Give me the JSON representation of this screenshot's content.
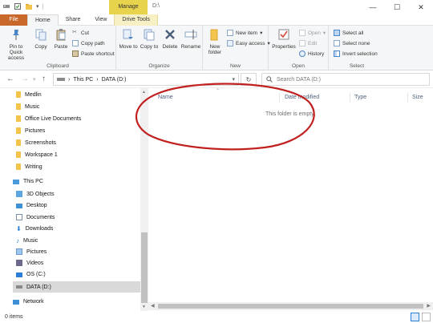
{
  "titlebar": {
    "context_tab": "Manage",
    "path": "D:\\",
    "minimize": "—",
    "maximize": "☐",
    "close": "✕"
  },
  "tabs": [
    {
      "label": "File"
    },
    {
      "label": "Home"
    },
    {
      "label": "Share"
    },
    {
      "label": "View"
    },
    {
      "label": "Drive Tools"
    }
  ],
  "ribbon": {
    "clipboard": {
      "label": "Clipboard",
      "pin": "Pin to Quick access",
      "copy": "Copy",
      "paste": "Paste",
      "cut": "Cut",
      "copy_path": "Copy path",
      "paste_shortcut": "Paste shortcut"
    },
    "organize": {
      "label": "Organize",
      "move_to": "Move to",
      "copy_to": "Copy to",
      "delete": "Delete",
      "rename": "Rename"
    },
    "new": {
      "label": "New",
      "new_folder": "New folder",
      "new_item": "New item",
      "easy_access": "Easy access"
    },
    "open": {
      "label": "Open",
      "properties": "Properties",
      "open": "Open",
      "edit": "Edit",
      "history": "History"
    },
    "select": {
      "label": "Select",
      "select_all": "Select all",
      "select_none": "Select none",
      "invert": "Invert selection"
    }
  },
  "address": {
    "segments": [
      "This PC",
      "DATA (D:)"
    ],
    "search_placeholder": "Search DATA (D:)"
  },
  "navpane": {
    "quick_items": [
      "Medlin",
      "Music",
      "Office Live Documents",
      "Pictures",
      "Screenshots",
      "Workspace 1",
      "Writing"
    ],
    "this_pc": "This PC",
    "pc_items": [
      "3D Objects",
      "Desktop",
      "Documents",
      "Downloads",
      "Music",
      "Pictures",
      "Videos",
      "OS (C:)",
      "DATA (D:)"
    ],
    "network": "Network"
  },
  "content": {
    "columns": [
      "Name",
      "Date modified",
      "Type",
      "Size"
    ],
    "empty_message": "This folder is empty."
  },
  "status": {
    "item_count": "0 items"
  },
  "colors": {
    "file_tab": "#c8682a",
    "manage_tab": "#e8d34d",
    "annotation": "#c0201f",
    "selected_nav": "#d9d9d9"
  }
}
